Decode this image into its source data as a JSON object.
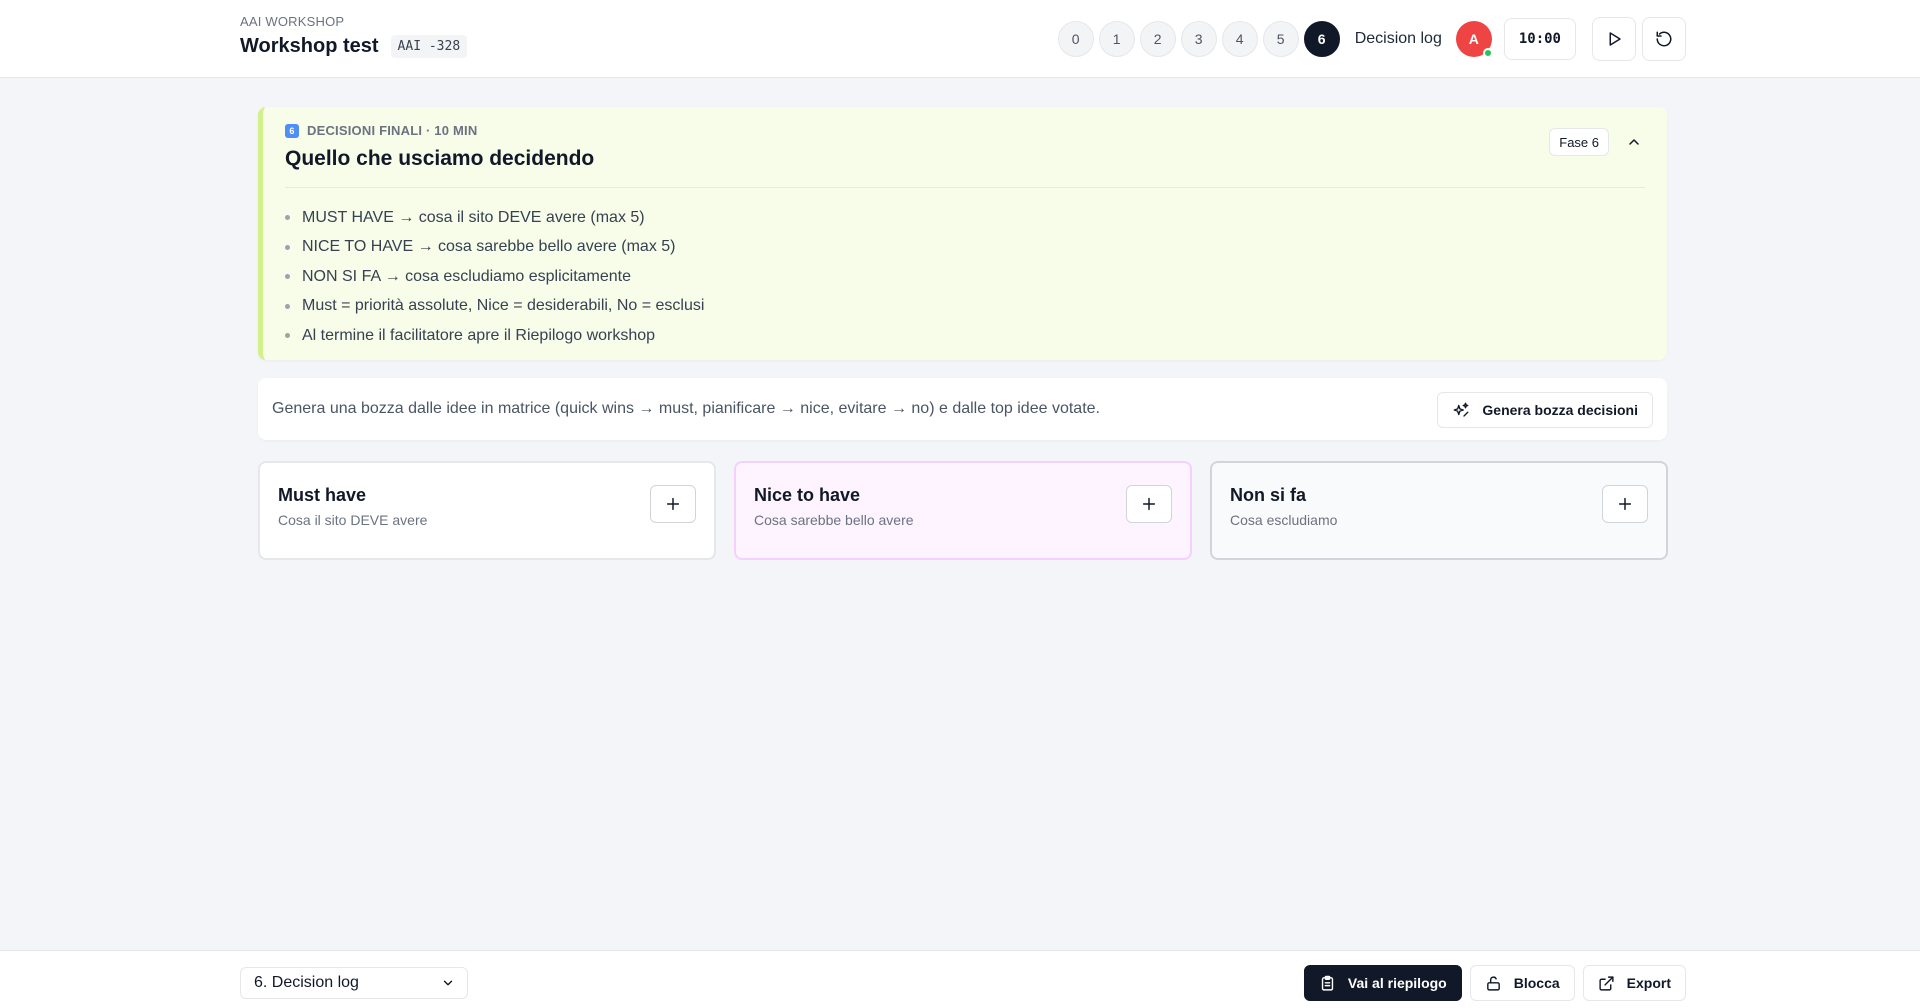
{
  "header": {
    "org": "AAI WORKSHOP",
    "title": "Workshop test",
    "code": "AAI -328",
    "phases": [
      "0",
      "1",
      "2",
      "3",
      "4",
      "5",
      "6"
    ],
    "active_phase": "6",
    "decision_log_label": "Decision log",
    "avatar_initial": "A",
    "timer": "10:00"
  },
  "phase_card": {
    "label": "DECISIONI FINALI · 10 MIN",
    "phase_icon": "6",
    "heading": "Quello che usciamo decidendo",
    "chip": "Fase 6",
    "bullets": [
      "MUST HAVE → cosa il sito DEVE avere (max 5)",
      "NICE TO HAVE → cosa sarebbe bello avere (max 5)",
      "NON SI FA → cosa escludiamo esplicitamente",
      "Must = priorità assolute, Nice = desiderabili, No = esclusi",
      "Al termine il facilitatore apre il Riepilogo workshop"
    ]
  },
  "draft": {
    "text": "Genera una bozza dalle idee in matrice (quick wins → must, pianificare → nice, evitare → no) e dalle top idee votate.",
    "button_label": "Genera bozza decisioni"
  },
  "columns": [
    {
      "title": "Must have",
      "subtitle": "Cosa il sito DEVE avere"
    },
    {
      "title": "Nice to have",
      "subtitle": "Cosa sarebbe bello avere"
    },
    {
      "title": "Non si fa",
      "subtitle": "Cosa escludiamo"
    }
  ],
  "footer": {
    "phase_select": "6. Decision log",
    "summary_button": "Vai al riepilogo",
    "lock_button": "Blocca",
    "export_button": "Export"
  },
  "colors": {
    "phase_card_bg": "#f7fde9",
    "phase_card_accent": "#d4f08a",
    "nice_bg": "#fdf4ff",
    "primary_dark": "#111827",
    "avatar_red": "#ef4444",
    "online_green": "#22c55e"
  },
  "icons": {
    "play": "play-icon",
    "reset": "reset-icon",
    "collapse": "chevron-up-icon",
    "sparkle": "sparkles-icon",
    "add": "plus-icon",
    "clipboard": "clipboard-icon",
    "lock": "unlock-icon",
    "export": "external-link-icon",
    "select": "chevron-down-icon"
  }
}
